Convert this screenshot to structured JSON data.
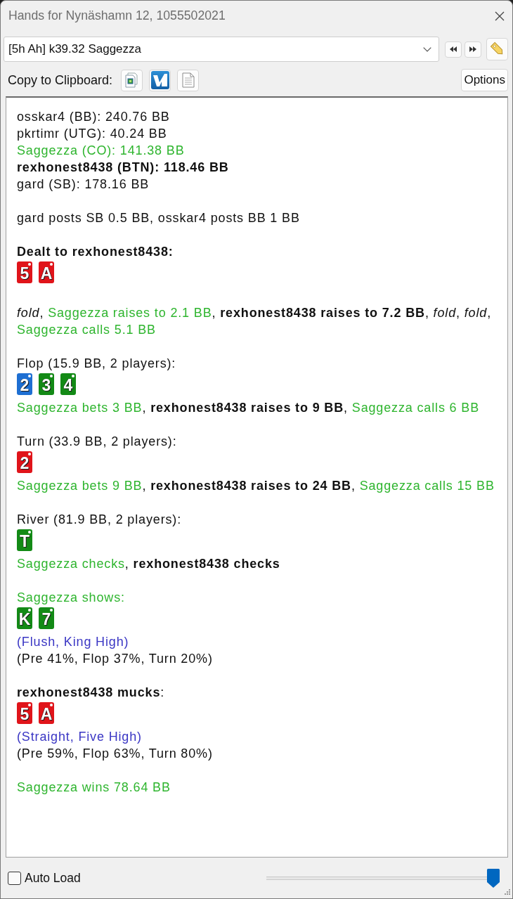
{
  "window": {
    "title": "Hands for Nynäshamn 12, 1055502021"
  },
  "hand_selector": {
    "value": "[5h Ah] k39.32 Saggezza"
  },
  "toolbar": {
    "label": "Copy to Clipboard:",
    "options_button": "Options"
  },
  "log": {
    "sections": [
      {
        "lines": [
          {
            "kind": "text",
            "segments": [
              {
                "text": "osskar4 (BB): 240.76 BB",
                "kind": "player"
              }
            ]
          },
          {
            "kind": "text",
            "segments": [
              {
                "text": "pkrtimr (UTG): 40.24 BB",
                "kind": "player"
              }
            ]
          },
          {
            "kind": "text",
            "segments": [
              {
                "text": "Saggezza (CO): 141.38 BB",
                "kind": "opponent"
              }
            ]
          },
          {
            "kind": "text",
            "segments": [
              {
                "text": "rexhonest8438 (BTN): 118.46 BB",
                "kind": "hero"
              }
            ]
          },
          {
            "kind": "text",
            "segments": [
              {
                "text": "gard (SB): 178.16 BB",
                "kind": "player"
              }
            ]
          }
        ]
      },
      {
        "lines": [
          {
            "kind": "text",
            "segments": [
              {
                "text": "gard posts SB 0.5 BB",
                "kind": "player",
                "punct": ","
              },
              {
                "text": "osskar4 posts BB 1 BB",
                "kind": "player"
              }
            ]
          }
        ]
      },
      {
        "lines": [
          {
            "kind": "text",
            "segments": [
              {
                "text": "Dealt to rexhonest8438:",
                "kind": "hero"
              }
            ]
          },
          {
            "kind": "cards",
            "cards": [
              {
                "rank": "5",
                "color": "#e0141a"
              },
              {
                "rank": "A",
                "color": "#e0141a"
              }
            ]
          }
        ]
      },
      {
        "lines": [
          {
            "kind": "text",
            "segments": [
              {
                "text": "fold",
                "kind": "folded",
                "punct": ","
              },
              {
                "text": "Saggezza raises to 2.1 BB",
                "kind": "opponent",
                "punct": ","
              },
              {
                "text": "rexhonest8438 raises to 7.2 BB",
                "kind": "hero",
                "punct": ","
              },
              {
                "text": "fold",
                "kind": "folded",
                "punct": ","
              },
              {
                "text": "fold",
                "kind": "folded",
                "punct": ","
              },
              {
                "text": "Saggezza calls 5.1 BB",
                "kind": "opponent"
              }
            ]
          }
        ]
      },
      {
        "lines": [
          {
            "kind": "text",
            "segments": [
              {
                "text": "Flop (15.9 BB, 2 players):",
                "kind": "player"
              }
            ]
          },
          {
            "kind": "cards",
            "cards": [
              {
                "rank": "2",
                "color": "#1e6fd2"
              },
              {
                "rank": "3",
                "color": "#138a16"
              },
              {
                "rank": "4",
                "color": "#138a16"
              }
            ]
          },
          {
            "kind": "text",
            "segments": [
              {
                "text": "Saggezza bets 3 BB",
                "kind": "opponent",
                "punct": ","
              },
              {
                "text": "rexhonest8438 raises to 9 BB",
                "kind": "hero",
                "punct": ","
              },
              {
                "text": "Saggezza calls 6 BB",
                "kind": "opponent"
              }
            ]
          }
        ]
      },
      {
        "lines": [
          {
            "kind": "text",
            "segments": [
              {
                "text": "Turn (33.9 BB, 2 players):",
                "kind": "player"
              }
            ]
          },
          {
            "kind": "cards",
            "cards": [
              {
                "rank": "2",
                "color": "#e0141a"
              }
            ]
          },
          {
            "kind": "text",
            "segments": [
              {
                "text": "Saggezza bets 9 BB",
                "kind": "opponent",
                "punct": ","
              },
              {
                "text": "rexhonest8438 raises to 24 BB",
                "kind": "hero",
                "punct": ","
              },
              {
                "text": "Saggezza calls 15 BB",
                "kind": "opponent"
              }
            ]
          }
        ]
      },
      {
        "lines": [
          {
            "kind": "text",
            "segments": [
              {
                "text": "River (81.9 BB, 2 players):",
                "kind": "player"
              }
            ]
          },
          {
            "kind": "cards",
            "cards": [
              {
                "rank": "T",
                "color": "#138a16"
              }
            ]
          },
          {
            "kind": "text",
            "segments": [
              {
                "text": "Saggezza checks",
                "kind": "opponent",
                "punct": ","
              },
              {
                "text": "rexhonest8438 checks",
                "kind": "hero"
              }
            ]
          }
        ]
      },
      {
        "lines": [
          {
            "kind": "text",
            "segments": [
              {
                "text": "Saggezza shows:",
                "kind": "opponent"
              }
            ]
          },
          {
            "kind": "cards",
            "cards": [
              {
                "rank": "K",
                "color": "#138a16"
              },
              {
                "rank": "7",
                "color": "#138a16"
              }
            ]
          },
          {
            "kind": "text",
            "segments": [
              {
                "text": "(Flush, King High)",
                "kind": "hand_rank"
              }
            ]
          },
          {
            "kind": "text",
            "segments": [
              {
                "text": "(Pre 41%, Flop 37%, Turn 20%)",
                "kind": "player"
              }
            ]
          }
        ]
      },
      {
        "lines": [
          {
            "kind": "text",
            "segments": [
              {
                "text": "rexhonest8438 mucks",
                "kind": "hero",
                "punct": ":"
              }
            ]
          },
          {
            "kind": "cards",
            "cards": [
              {
                "rank": "5",
                "color": "#e0141a"
              },
              {
                "rank": "A",
                "color": "#e0141a"
              }
            ]
          },
          {
            "kind": "text",
            "segments": [
              {
                "text": "(Straight, Five High)",
                "kind": "hand_rank"
              }
            ]
          },
          {
            "kind": "text",
            "segments": [
              {
                "text": "(Pre 59%, Flop 63%, Turn 80%)",
                "kind": "player"
              }
            ]
          }
        ]
      },
      {
        "lines": [
          {
            "kind": "text",
            "segments": [
              {
                "text": "Saggezza wins 78.64 BB",
                "kind": "opponent"
              }
            ]
          }
        ]
      }
    ]
  },
  "footer": {
    "auto_load": {
      "label": "Auto Load",
      "checked": false
    },
    "slider": {
      "level": 1
    }
  }
}
